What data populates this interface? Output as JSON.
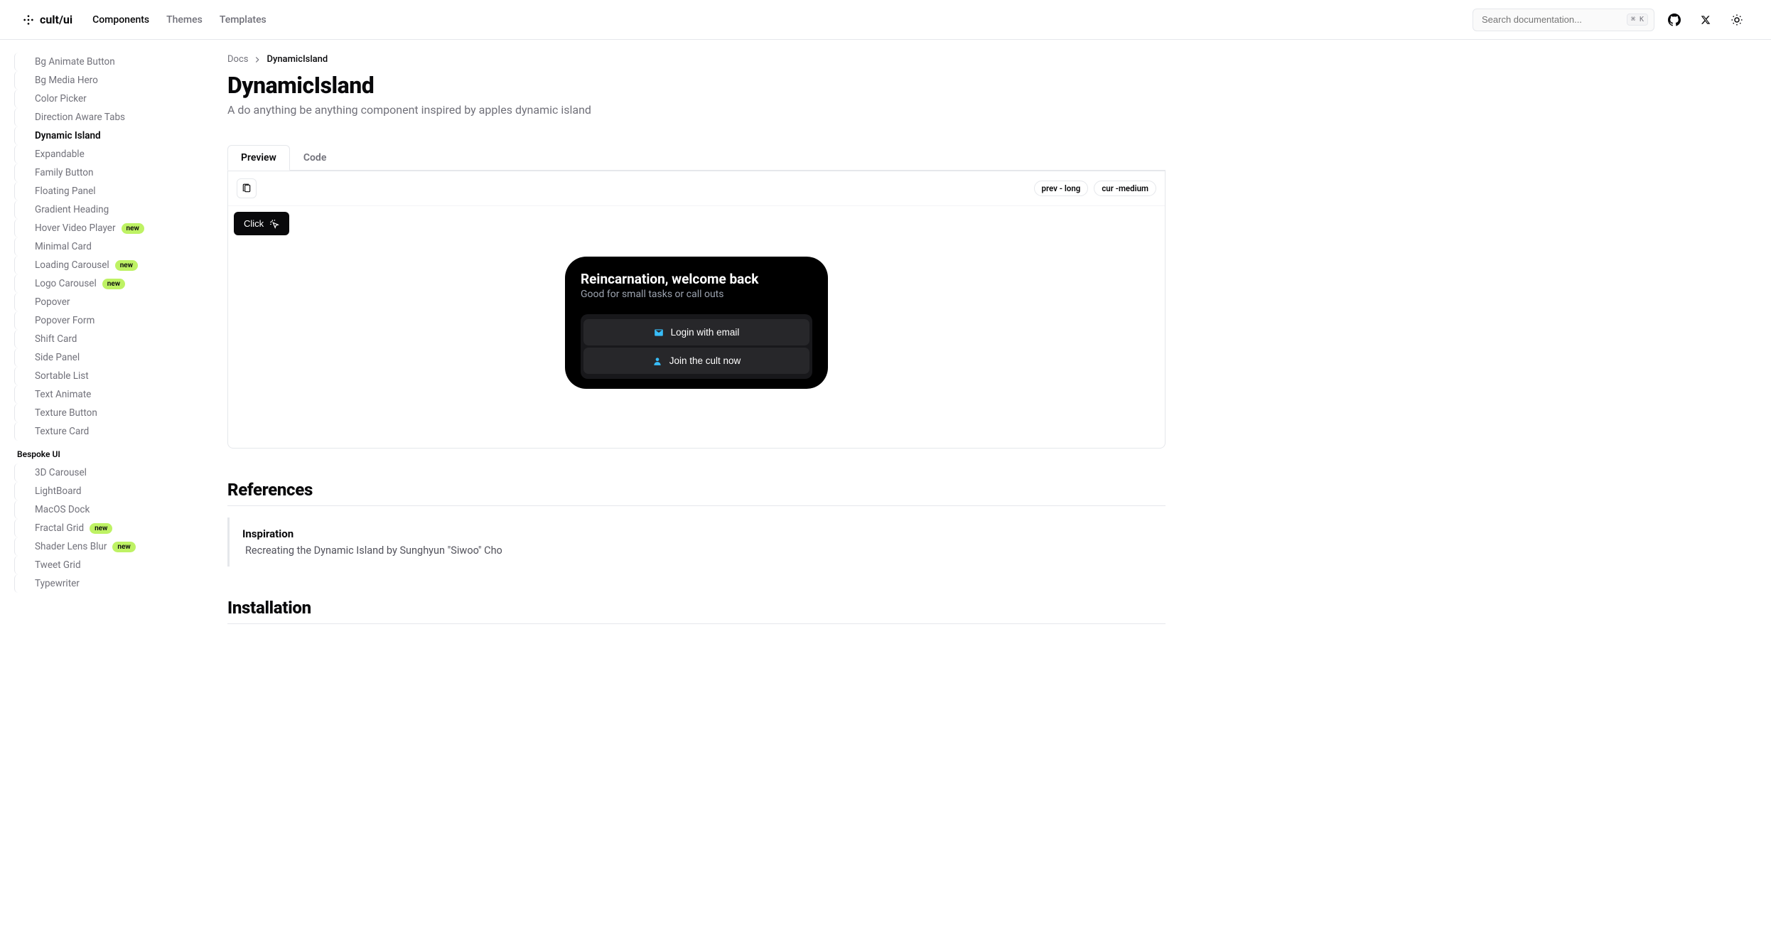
{
  "header": {
    "brand": "cult/ui",
    "nav": [
      {
        "label": "Components",
        "active": true
      },
      {
        "label": "Themes",
        "active": false
      },
      {
        "label": "Templates",
        "active": false
      }
    ],
    "search_placeholder": "Search documentation...",
    "kbd": "⌘ K"
  },
  "sidebar": {
    "items1": [
      {
        "label": "Bg Animate Button"
      },
      {
        "label": "Bg Media Hero"
      },
      {
        "label": "Color Picker"
      },
      {
        "label": "Direction Aware Tabs"
      },
      {
        "label": "Dynamic Island",
        "active": true
      },
      {
        "label": "Expandable"
      },
      {
        "label": "Family Button"
      },
      {
        "label": "Floating Panel"
      },
      {
        "label": "Gradient Heading"
      },
      {
        "label": "Hover Video Player",
        "badge": "new"
      },
      {
        "label": "Minimal Card"
      },
      {
        "label": "Loading Carousel",
        "badge": "new"
      },
      {
        "label": "Logo Carousel",
        "badge": "new"
      },
      {
        "label": "Popover"
      },
      {
        "label": "Popover Form"
      },
      {
        "label": "Shift Card"
      },
      {
        "label": "Side Panel"
      },
      {
        "label": "Sortable List"
      },
      {
        "label": "Text Animate"
      },
      {
        "label": "Texture Button"
      },
      {
        "label": "Texture Card"
      }
    ],
    "heading2": "Bespoke UI",
    "items2": [
      {
        "label": "3D Carousel"
      },
      {
        "label": "LightBoard"
      },
      {
        "label": "MacOS Dock"
      },
      {
        "label": "Fractal Grid",
        "badge": "new"
      },
      {
        "label": "Shader Lens Blur",
        "badge": "new"
      },
      {
        "label": "Tweet Grid"
      },
      {
        "label": "Typewriter"
      }
    ]
  },
  "breadcrumb": {
    "root": "Docs",
    "current": "DynamicIsland"
  },
  "page": {
    "title": "DynamicIsland",
    "desc": "A do anything be anything component inspired by apples dynamic island"
  },
  "tabs": [
    {
      "label": "Preview",
      "active": true
    },
    {
      "label": "Code",
      "active": false
    }
  ],
  "preview": {
    "state_prev": "prev - long",
    "state_cur": "cur -medium",
    "click_label": "Click",
    "island": {
      "title": "Reincarnation, welcome back",
      "sub": "Good for small tasks or call outs",
      "btn1": "Login with email",
      "btn2": "Join the cult now"
    }
  },
  "references": {
    "heading": "References",
    "card_title": "Inspiration",
    "card_desc": "Recreating the Dynamic Island by Sunghyun \"Siwoo\" Cho"
  },
  "installation": {
    "heading": "Installation"
  }
}
